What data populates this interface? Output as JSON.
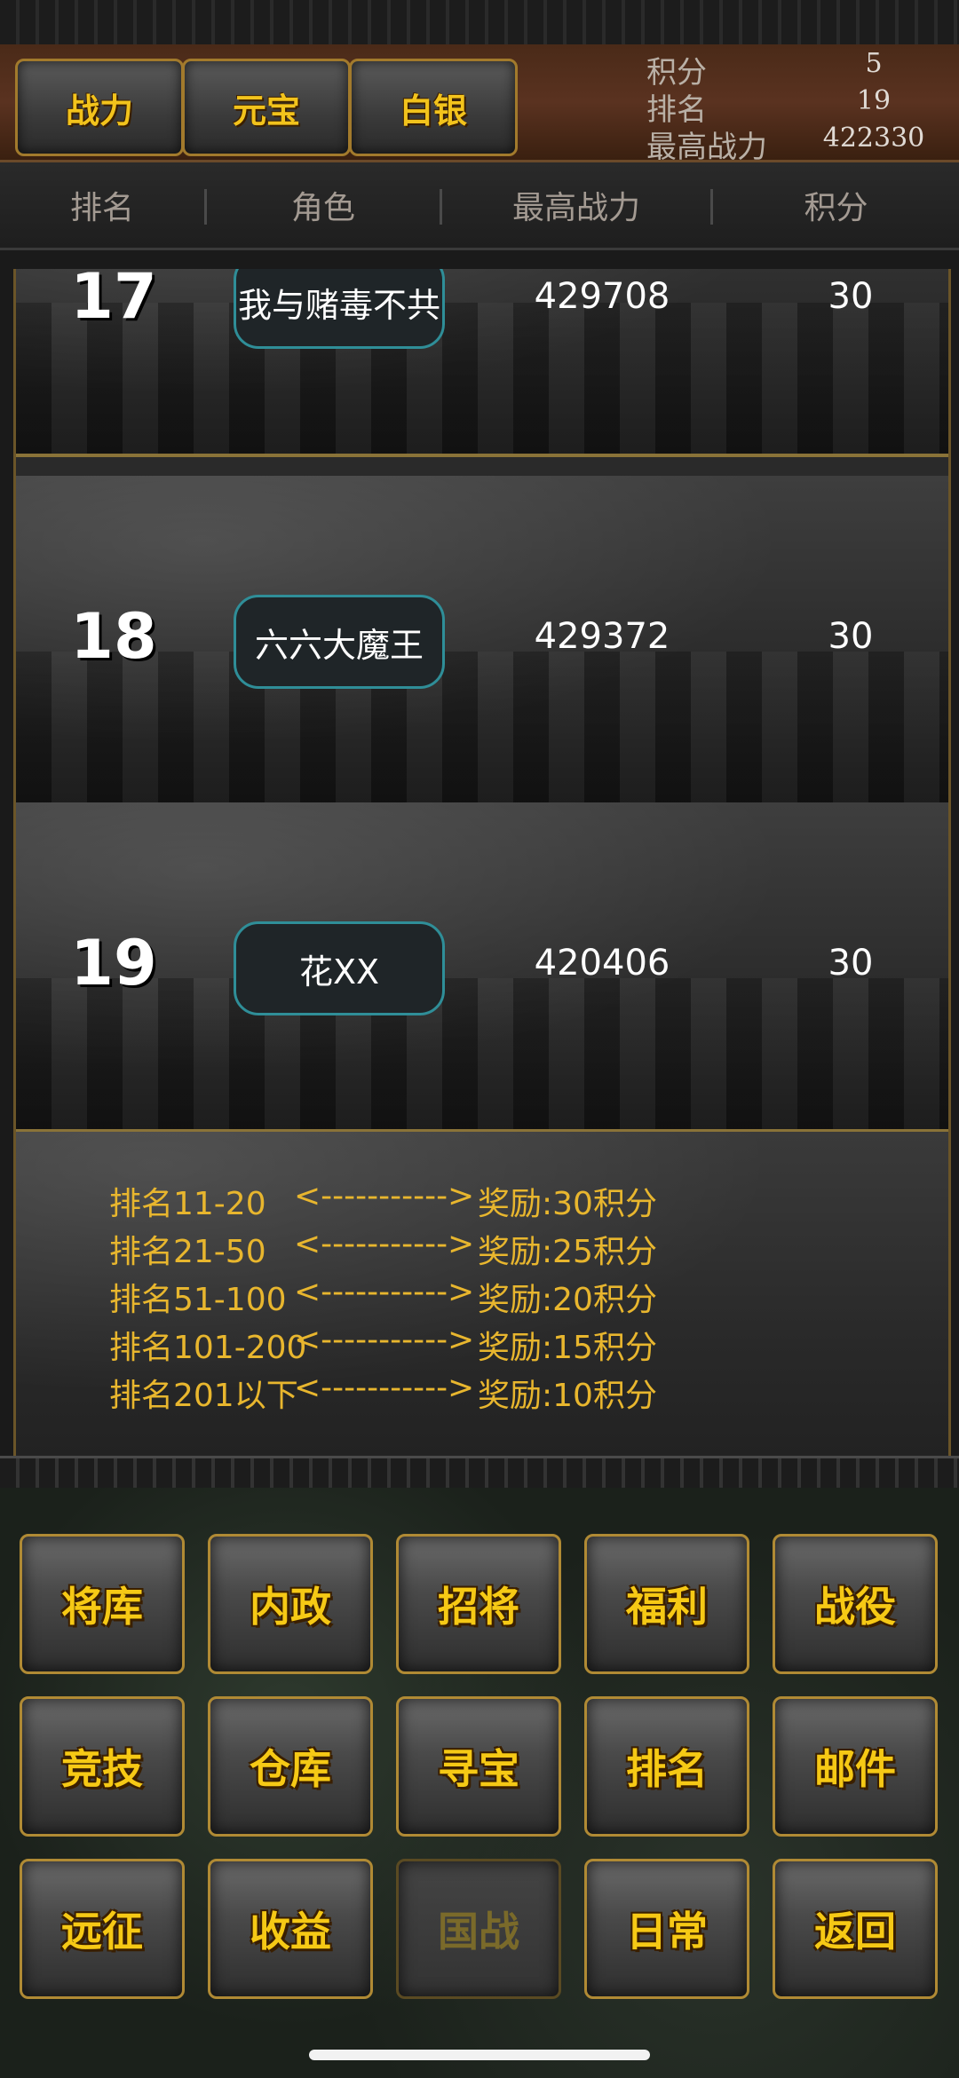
{
  "tabs": [
    "战力",
    "元宝",
    "白银"
  ],
  "stats": [
    {
      "label": "积分",
      "value": "5"
    },
    {
      "label": "排名",
      "value": "19"
    },
    {
      "label": "最高战力",
      "value": "422330"
    }
  ],
  "columns": [
    "排名",
    "角色",
    "最高战力",
    "积分"
  ],
  "rows": [
    {
      "rank": "17",
      "name": "我与赌毒不共",
      "power": "429708",
      "score": "30"
    },
    {
      "rank": "18",
      "name": "六六大魔王",
      "power": "429372",
      "score": "30"
    },
    {
      "rank": "19",
      "name": "花XX",
      "power": "420406",
      "score": "30"
    }
  ],
  "rewards": [
    {
      "range": "排名11-20",
      "arrow": "<----------->",
      "reward": "奖励:30积分"
    },
    {
      "range": "排名21-50",
      "arrow": "<----------->",
      "reward": "奖励:25积分"
    },
    {
      "range": "排名51-100",
      "arrow": "<----------->",
      "reward": "奖励:20积分"
    },
    {
      "range": "排名101-200",
      "arrow": "<----------->",
      "reward": "奖励:15积分"
    },
    {
      "range": "排名201以下",
      "arrow": "<----------->",
      "reward": "奖励:10积分"
    }
  ],
  "menu": [
    "将库",
    "内政",
    "招将",
    "福利",
    "战役",
    "竞技",
    "仓库",
    "寻宝",
    "排名",
    "邮件",
    "远征",
    "收益",
    "国战",
    "日常",
    "返回"
  ]
}
